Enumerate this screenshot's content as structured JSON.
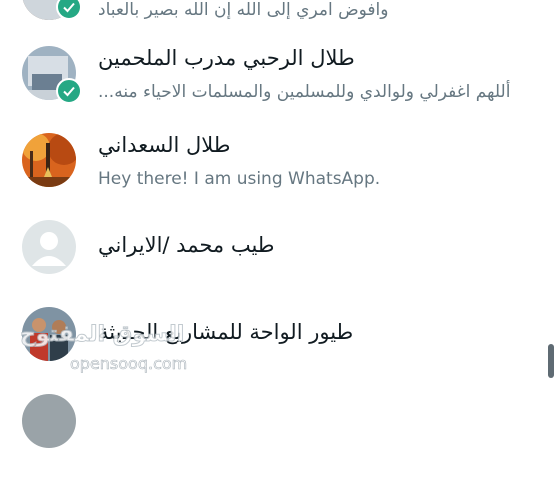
{
  "contacts": [
    {
      "name": "",
      "status": "وافوض امري إلى الله إن الله بصير بالعباد",
      "avatar": "photo-avatar",
      "verified": true
    },
    {
      "name": "طلال الرحبي مدرب الملحمين",
      "status": "أللهم اغفرلي ولوالدي وللمسلمين والمسلمات الاحياء منه...",
      "avatar": "photo-avatar",
      "verified": true
    },
    {
      "name": "طلال السعداني",
      "status": "Hey there! I am using WhatsApp.",
      "avatar": "autumn-forest-avatar",
      "verified": false
    },
    {
      "name": "طيب محمد /الايراني",
      "status": "",
      "avatar": "default-person-avatar",
      "verified": false
    },
    {
      "name": "طيور الواحة للمشاريع الحديثة",
      "status": "",
      "avatar": "people-photo-avatar",
      "verified": false
    }
  ],
  "watermark": {
    "ar": "السوق المفتوح",
    "en": "opensooq.com"
  },
  "colors": {
    "accent": "#25a884",
    "name": "#111b21",
    "status": "#667781"
  }
}
